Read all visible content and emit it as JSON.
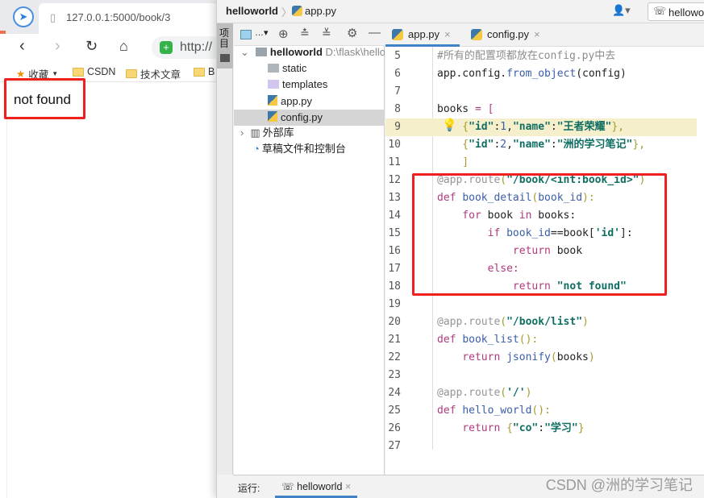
{
  "browser": {
    "tab_title": "127.0.0.1:5000/book/3",
    "url": "http://",
    "bookmarks": [
      "收藏",
      "CSDN",
      "技术文章",
      "B"
    ],
    "page_text": "not found"
  },
  "ide": {
    "breadcrumb": [
      "helloworld",
      "app.py"
    ],
    "run_config": "helloworld",
    "side_tab": "项目",
    "tree": [
      {
        "label": "helloworld",
        "extra": "D:\\flask\\hello",
        "type": "root"
      },
      {
        "label": "static",
        "type": "folder"
      },
      {
        "label": "templates",
        "type": "tfolder"
      },
      {
        "label": "app.py",
        "type": "py"
      },
      {
        "label": "config.py",
        "type": "py",
        "selected": true
      },
      {
        "label": "外部库",
        "type": "lib"
      },
      {
        "label": "草稿文件和控制台",
        "type": "scratch"
      }
    ],
    "editor_tabs": [
      {
        "label": "app.py",
        "active": true
      },
      {
        "label": "config.py",
        "active": false
      }
    ],
    "code": [
      {
        "n": "5",
        "t": [
          [
            "#所有的配置项都放在config.py中去",
            "cm"
          ]
        ]
      },
      {
        "n": "6",
        "t": [
          [
            "app.config.",
            "pl"
          ],
          [
            "from_object",
            "fn"
          ],
          [
            "(config)",
            "pl"
          ]
        ]
      },
      {
        "n": "7",
        "t": []
      },
      {
        "n": "8",
        "t": [
          [
            "books ",
            "pl"
          ],
          [
            "= [",
            "kw"
          ]
        ]
      },
      {
        "n": "9",
        "hl": true,
        "t": [
          [
            "    {",
            "pu"
          ],
          [
            "\"id\"",
            "st"
          ],
          [
            ":",
            "pl"
          ],
          [
            "1",
            "nm"
          ],
          [
            ",",
            "pl"
          ],
          [
            "\"name\"",
            "st"
          ],
          [
            ":",
            "pl"
          ],
          [
            "\"王者荣耀\"",
            "st"
          ],
          [
            "},",
            "pu"
          ]
        ]
      },
      {
        "n": "10",
        "t": [
          [
            "    {",
            "pu"
          ],
          [
            "\"id\"",
            "st"
          ],
          [
            ":",
            "pl"
          ],
          [
            "2",
            "nm"
          ],
          [
            ",",
            "pl"
          ],
          [
            "\"name\"",
            "st"
          ],
          [
            ":",
            "pl"
          ],
          [
            "\"洲的学习笔记\"",
            "st"
          ],
          [
            "},",
            "pu"
          ]
        ]
      },
      {
        "n": "11",
        "t": [
          [
            "    ]",
            "pu"
          ]
        ]
      },
      {
        "n": "12",
        "t": [
          [
            "@app.route",
            "dc"
          ],
          [
            "(",
            "pu"
          ],
          [
            "\"/book/<int:book_id>\"",
            "st"
          ],
          [
            ")",
            "pu"
          ]
        ]
      },
      {
        "n": "13",
        "t": [
          [
            "def ",
            "kw"
          ],
          [
            "book_detail",
            "fn"
          ],
          [
            "(",
            "pu"
          ],
          [
            "book_id",
            "fn"
          ],
          [
            "):",
            "pu"
          ]
        ]
      },
      {
        "n": "14",
        "t": [
          [
            "    for ",
            "kw"
          ],
          [
            "book ",
            "pl"
          ],
          [
            "in ",
            "kw"
          ],
          [
            "books:",
            "pl"
          ]
        ]
      },
      {
        "n": "15",
        "t": [
          [
            "        if ",
            "kw"
          ],
          [
            "book_id",
            "fn"
          ],
          [
            "==book[",
            "pl"
          ],
          [
            "'id'",
            "st"
          ],
          [
            "]:",
            "pl"
          ]
        ]
      },
      {
        "n": "16",
        "t": [
          [
            "            return ",
            "kw"
          ],
          [
            "book",
            "pl"
          ]
        ]
      },
      {
        "n": "17",
        "t": [
          [
            "        else:",
            "kw"
          ]
        ]
      },
      {
        "n": "18",
        "t": [
          [
            "            return ",
            "kw"
          ],
          [
            "\"not found\"",
            "st"
          ]
        ]
      },
      {
        "n": "19",
        "t": []
      },
      {
        "n": "20",
        "t": [
          [
            "@app.route",
            "dc"
          ],
          [
            "(",
            "pu"
          ],
          [
            "\"/book/list\"",
            "st"
          ],
          [
            ")",
            "pu"
          ]
        ]
      },
      {
        "n": "21",
        "t": [
          [
            "def ",
            "kw"
          ],
          [
            "book_list",
            "fn"
          ],
          [
            "():",
            "pu"
          ]
        ]
      },
      {
        "n": "22",
        "t": [
          [
            "    return ",
            "kw"
          ],
          [
            "jsonify",
            "fn"
          ],
          [
            "(",
            "pu"
          ],
          [
            "books",
            "pl"
          ],
          [
            ")",
            "pu"
          ]
        ]
      },
      {
        "n": "23",
        "t": []
      },
      {
        "n": "24",
        "t": [
          [
            "@app.route",
            "dc"
          ],
          [
            "(",
            "pu"
          ],
          [
            "'/'",
            "st"
          ],
          [
            ")",
            "pu"
          ]
        ]
      },
      {
        "n": "25",
        "t": [
          [
            "def ",
            "kw"
          ],
          [
            "hello_world",
            "fn"
          ],
          [
            "():",
            "pu"
          ]
        ]
      },
      {
        "n": "26",
        "t": [
          [
            "    return ",
            "kw"
          ],
          [
            "{",
            "pu"
          ],
          [
            "\"co\"",
            "st"
          ],
          [
            ":",
            "pl"
          ],
          [
            "\"学习\"",
            "st"
          ],
          [
            "}",
            "pu"
          ]
        ]
      },
      {
        "n": "27",
        "t": []
      }
    ],
    "run_label": "运行:",
    "run_tab": "helloworld"
  },
  "watermark": "CSDN @洲的学习笔记",
  "colors": {
    "highlight_box": "#f02020",
    "current_line": "#f5efcc",
    "tab_accent": "#4083c9"
  }
}
